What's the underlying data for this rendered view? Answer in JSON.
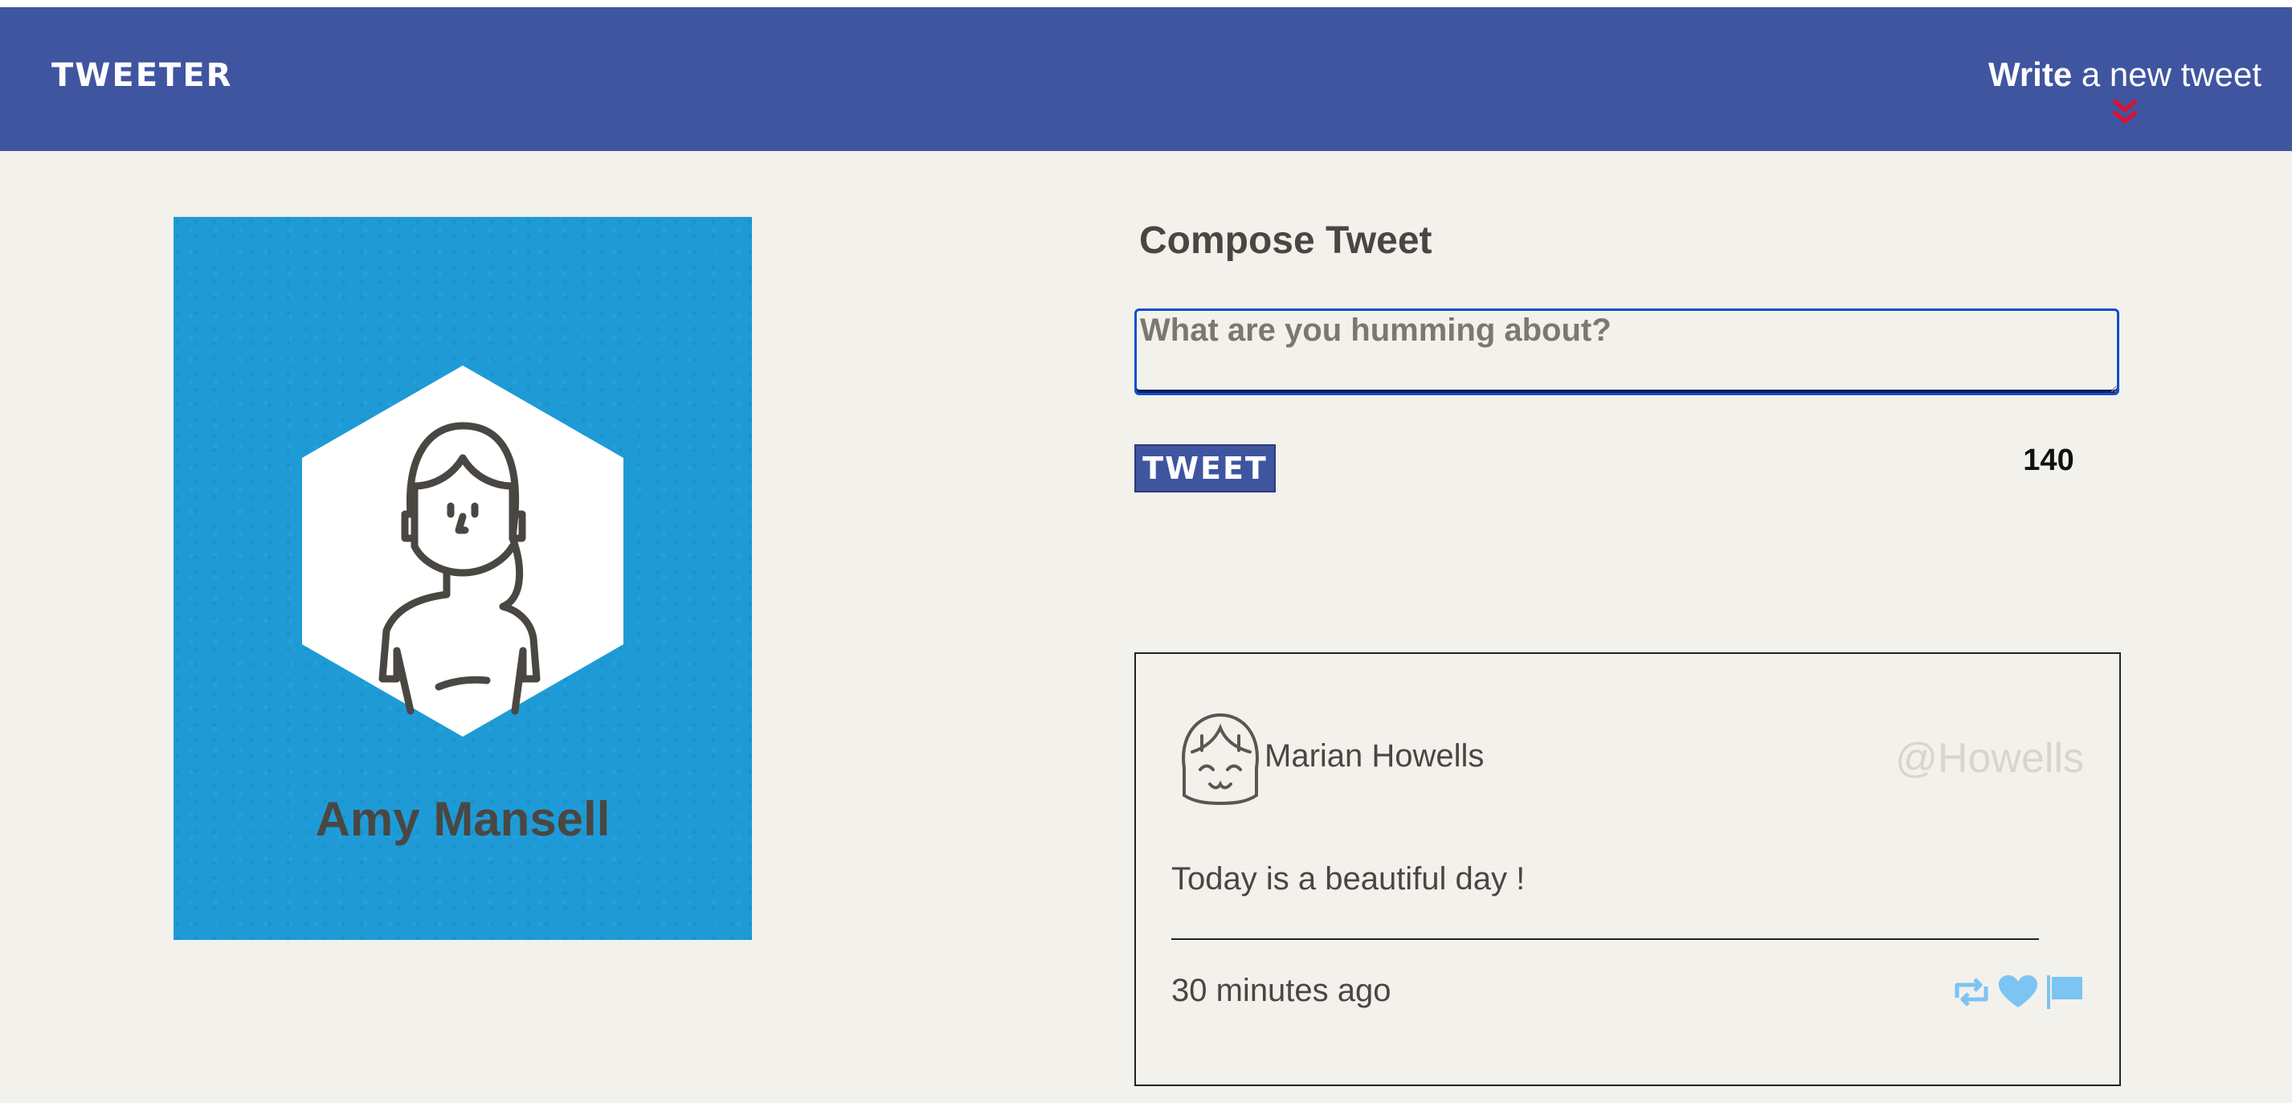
{
  "header": {
    "brand": "TWEETER",
    "write_bold": "Write",
    "write_rest": " a new tweet"
  },
  "profile": {
    "name": "Amy Mansell"
  },
  "compose": {
    "title": "Compose Tweet",
    "placeholder": "What are you humming about?",
    "button_label": "TWEET",
    "char_counter": "140"
  },
  "tweets": [
    {
      "author": "Marian Howells",
      "handle": "@Howells",
      "text": "Today is a beautiful day !",
      "time": "30 minutes ago",
      "actions": [
        "retweet-icon",
        "heart-icon",
        "flag-icon"
      ]
    }
  ],
  "colors": {
    "nav_bg": "#4055a0",
    "page_bg": "#f3f1ec",
    "profile_bg": "#1e9bd6",
    "chevron": "#e0102a",
    "action_icons": "#7cc4f2",
    "handle": "#d8d5cf"
  }
}
